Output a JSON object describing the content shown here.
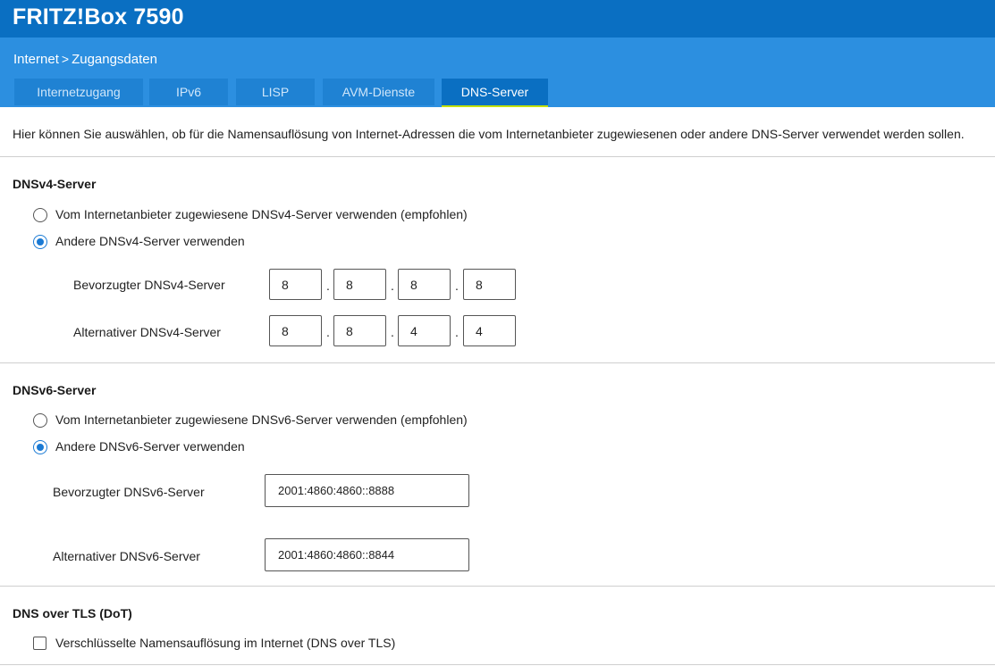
{
  "header": {
    "title": "FRITZ!Box 7590"
  },
  "breadcrumb": {
    "parent": "Internet",
    "separator": ">",
    "current": "Zugangsdaten"
  },
  "tabs": [
    {
      "label": "Internetzugang",
      "active": false
    },
    {
      "label": "IPv6",
      "active": false
    },
    {
      "label": "LISP",
      "active": false
    },
    {
      "label": "AVM-Dienste",
      "active": false
    },
    {
      "label": "DNS-Server",
      "active": true
    }
  ],
  "intro": "Hier können Sie auswählen, ob für die Namensauflösung von Internet-Adressen die vom Internetanbieter zugewiesenen oder andere DNS-Server verwendet werden sollen.",
  "dnsv4": {
    "title": "DNSv4-Server",
    "option_provider": "Vom Internetanbieter zugewiesene DNSv4-Server verwenden (empfohlen)",
    "option_other": "Andere DNSv4-Server verwenden",
    "selected": "other",
    "preferred_label": "Bevorzugter DNSv4-Server",
    "preferred": [
      "8",
      "8",
      "8",
      "8"
    ],
    "alternative_label": "Alternativer DNSv4-Server",
    "alternative": [
      "8",
      "8",
      "4",
      "4"
    ]
  },
  "dnsv6": {
    "title": "DNSv6-Server",
    "option_provider": "Vom Internetanbieter zugewiesene DNSv6-Server verwenden (empfohlen)",
    "option_other": "Andere DNSv6-Server verwenden",
    "selected": "other",
    "preferred_label": "Bevorzugter DNSv6-Server",
    "preferred": "2001:4860:4860::8888",
    "alternative_label": "Alternativer DNSv6-Server",
    "alternative": "2001:4860:4860::8844"
  },
  "dot": {
    "title": "DNS over TLS (DoT)",
    "checkbox_label": "Verschlüsselte Namensauflösung im Internet (DNS over TLS)",
    "checked": false
  },
  "colors": {
    "header_bg": "#0a6fc2",
    "subheader_bg": "#2c8fe0",
    "tab_bg": "#1f82d3",
    "active_tab_underline": "#c4e000",
    "radio_accent": "#1a7ad4"
  }
}
